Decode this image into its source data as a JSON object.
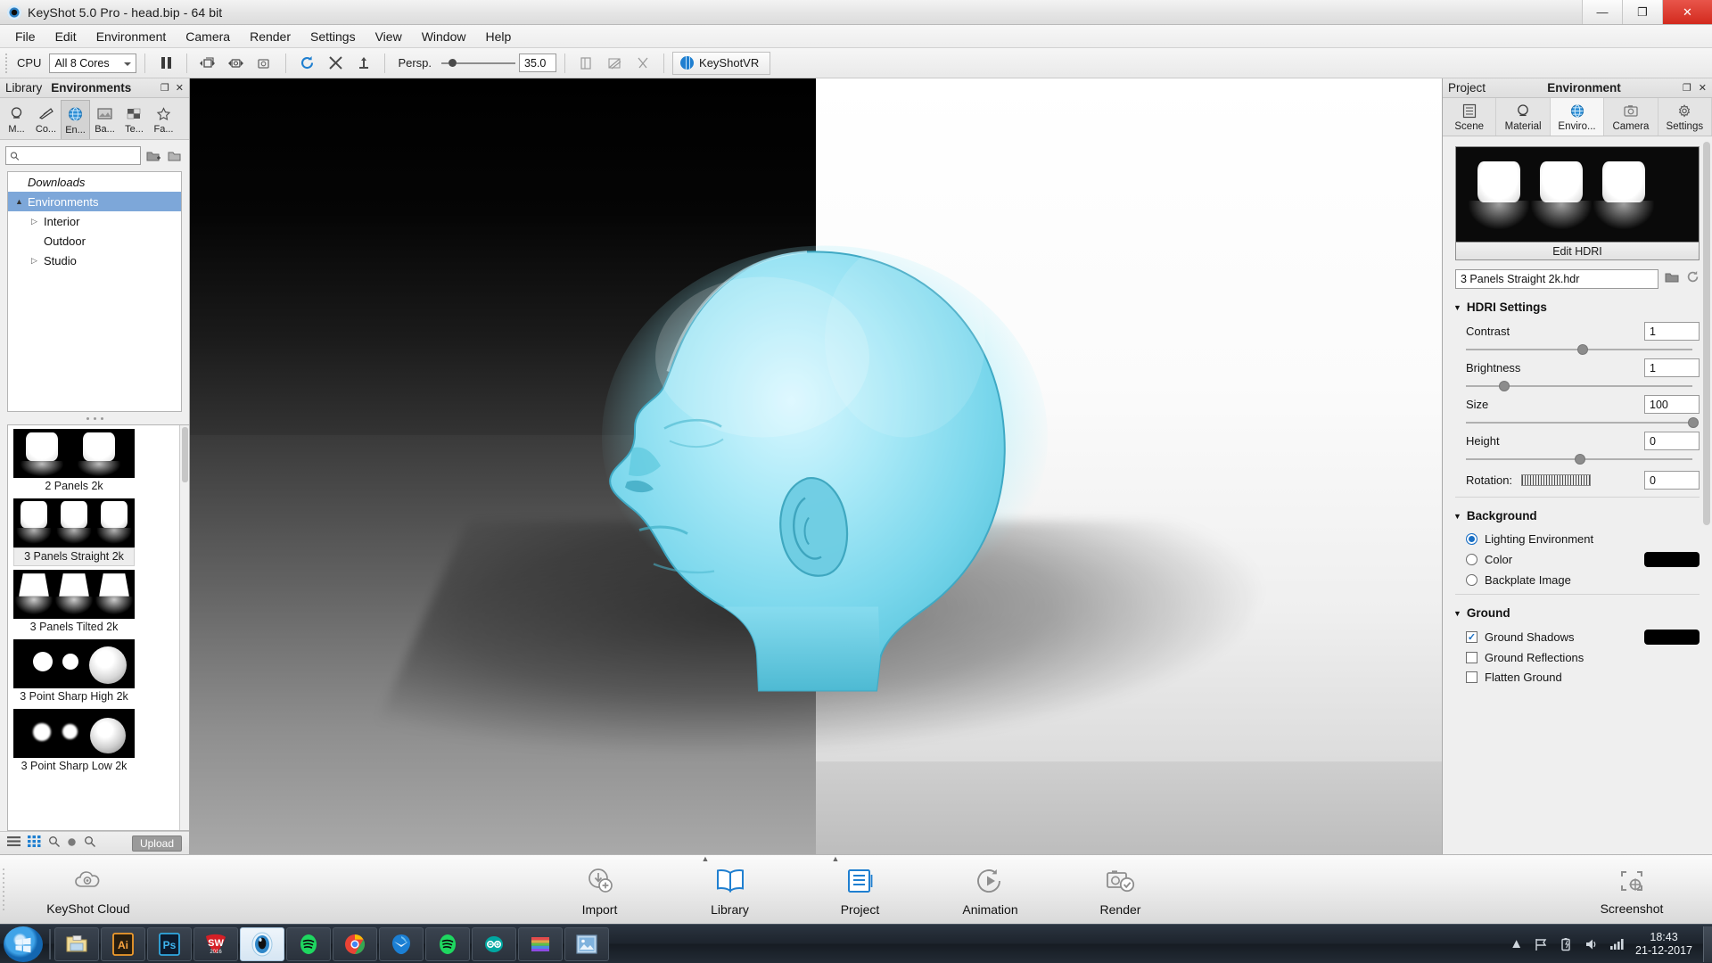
{
  "titlebar": {
    "title": "KeyShot 5.0 Pro  - head.bip  - 64 bit",
    "minimize": "—",
    "maximize": "❐",
    "close": "✕"
  },
  "menubar": {
    "items": [
      "File",
      "Edit",
      "Environment",
      "Camera",
      "Render",
      "Settings",
      "View",
      "Window",
      "Help"
    ]
  },
  "toolbar": {
    "cpu_label": "CPU",
    "cores_value": "All 8 Cores",
    "persp_label": "Persp.",
    "focal_value": "35.0",
    "vr_label": "KeyShotVR",
    "icons": [
      "pause-icon",
      "prev-camera-icon",
      "prev-snapshot-icon",
      "snapshot-icon",
      "refresh-icon",
      "move-tool-icon",
      "anchor-icon",
      "ruler-icon",
      "grid-icon",
      "scissors-icon"
    ]
  },
  "library": {
    "header_left": "Library",
    "header_title": "Environments",
    "tabs": [
      {
        "label": "M...",
        "icon": "material-icon"
      },
      {
        "label": "Co...",
        "icon": "color-icon"
      },
      {
        "label": "En...",
        "icon": "environment-globe-icon"
      },
      {
        "label": "Ba...",
        "icon": "backplate-icon"
      },
      {
        "label": "Te...",
        "icon": "texture-icon"
      },
      {
        "label": "Fa...",
        "icon": "favorites-star-icon"
      }
    ],
    "active_tab_index": 2,
    "search_placeholder": "",
    "tree": [
      {
        "label": "Downloads",
        "type": "root",
        "expander": "",
        "selected": false
      },
      {
        "label": "Environments",
        "type": "folder",
        "expander": "▲",
        "selected": true
      },
      {
        "label": "Interior",
        "type": "child",
        "expander": "▷",
        "selected": false
      },
      {
        "label": "Outdoor",
        "type": "child",
        "expander": "",
        "selected": false
      },
      {
        "label": "Studio",
        "type": "child",
        "expander": "▷",
        "selected": false
      }
    ],
    "thumbnails": [
      {
        "label": "2 Panels 2k",
        "panels": 2,
        "style": "straight",
        "selected": false
      },
      {
        "label": "3 Panels Straight 2k",
        "panels": 3,
        "style": "straight",
        "selected": true
      },
      {
        "label": "3 Panels Tilted 2k",
        "panels": 3,
        "style": "tilted",
        "selected": false
      },
      {
        "label": "3 Point Sharp High 2k",
        "panels": 3,
        "style": "points-high",
        "selected": false
      },
      {
        "label": "3 Point Sharp Low 2k",
        "panels": 3,
        "style": "points-low",
        "selected": false
      }
    ],
    "bottom": {
      "list_view": "list-view-icon",
      "grid_view": "grid-view-icon",
      "zoom_out": "zoom-out-icon",
      "dot": "dot-icon",
      "zoom_in": "zoom-in-icon",
      "upload_label": "Upload"
    }
  },
  "project": {
    "header_left": "Project",
    "header_title": "Environment",
    "undock_icon": "undock-icon",
    "close_icon": "close-icon",
    "tabs": [
      {
        "label": "Scene",
        "icon": "scene-list-icon"
      },
      {
        "label": "Material",
        "icon": "material-sphere-icon"
      },
      {
        "label": "Enviro...",
        "icon": "environment-globe-icon"
      },
      {
        "label": "Camera",
        "icon": "camera-icon"
      },
      {
        "label": "Settings",
        "icon": "gear-icon"
      }
    ],
    "active_tab_index": 2,
    "edit_hdri_label": "Edit HDRI",
    "hdri_file": "3 Panels Straight 2k.hdr",
    "hdri_open_icon": "folder-open-icon",
    "hdri_refresh_icon": "refresh-icon",
    "hdri_section_title": "HDRI Settings",
    "hdri_controls": [
      {
        "label": "Contrast",
        "value": "1",
        "slider_pct": 50
      },
      {
        "label": "Brightness",
        "value": "1",
        "slider_pct": 21
      },
      {
        "label": "Size",
        "value": "100",
        "slider_pct": 97
      },
      {
        "label": "Height",
        "value": "0",
        "slider_pct": 49
      }
    ],
    "rotation_label": "Rotation:",
    "rotation_value": "0",
    "background_title": "Background",
    "background_options": [
      {
        "label": "Lighting Environment",
        "selected": true,
        "swatch": null
      },
      {
        "label": "Color",
        "selected": false,
        "swatch": "#000000"
      },
      {
        "label": "Backplate Image",
        "selected": false,
        "swatch": null
      }
    ],
    "ground_title": "Ground",
    "ground_options": [
      {
        "label": "Ground Shadows",
        "checked": true,
        "swatch": "#000000"
      },
      {
        "label": "Ground Reflections",
        "checked": false,
        "swatch": null
      },
      {
        "label": "Flatten Ground",
        "checked": false,
        "swatch": null
      }
    ]
  },
  "viewport": {
    "model_color": "#7fdcee",
    "model_name": "head-model"
  },
  "dock": {
    "cloud_label": "KeyShot Cloud",
    "cloud_icon": "cloud-icon",
    "items": [
      {
        "label": "Import",
        "icon": "import-icon",
        "has_caret": false,
        "active": false
      },
      {
        "label": "Library",
        "icon": "library-book-icon",
        "has_caret": true,
        "active": true
      },
      {
        "label": "Project",
        "icon": "project-icon",
        "has_caret": true,
        "active": true
      },
      {
        "label": "Animation",
        "icon": "animation-icon",
        "has_caret": false,
        "active": false
      },
      {
        "label": "Render",
        "icon": "render-icon",
        "has_caret": false,
        "active": false
      }
    ],
    "screenshot_label": "Screenshot",
    "screenshot_icon": "screenshot-icon"
  },
  "taskbar": {
    "start_icon": "windows-start-icon",
    "apps": [
      {
        "name": "explorer-icon",
        "active": false
      },
      {
        "name": "illustrator-icon",
        "active": false
      },
      {
        "name": "photoshop-icon",
        "active": false
      },
      {
        "name": "solidworks-icon",
        "active": false
      },
      {
        "name": "keyshot-icon",
        "active": true
      },
      {
        "name": "spotify-icon",
        "active": false
      },
      {
        "name": "chrome-icon",
        "active": false
      },
      {
        "name": "thunderbird-icon",
        "active": false
      },
      {
        "name": "spotify-icon",
        "active": false
      },
      {
        "name": "arduino-icon",
        "active": false
      },
      {
        "name": "winrar-icon",
        "active": false
      },
      {
        "name": "photoviewer-icon",
        "active": false
      }
    ],
    "tray_icons": [
      "show-hidden-icon",
      "flag-icon",
      "battery-icon",
      "volume-icon",
      "network-icon"
    ],
    "time": "18:43",
    "date": "21-12-2017"
  }
}
